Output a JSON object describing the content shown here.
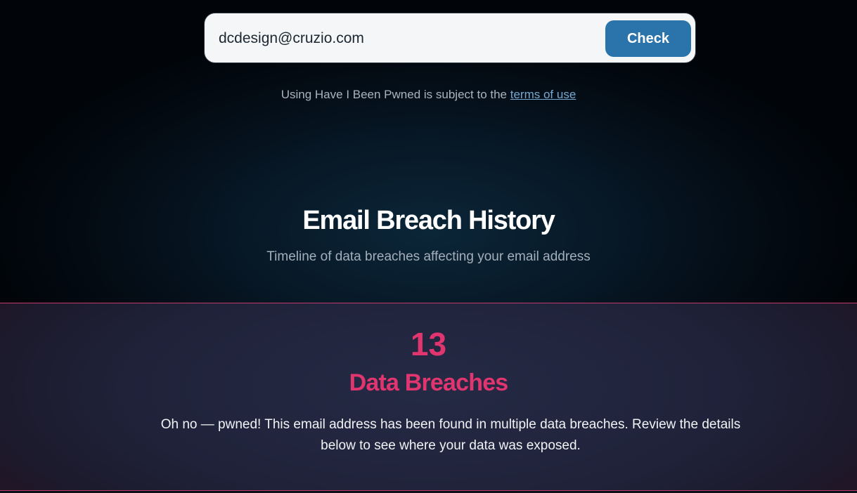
{
  "search": {
    "email_value": "dcdesign@cruzio.com",
    "check_label": "Check"
  },
  "terms": {
    "prefix": "Using Have I Been Pwned is subject to the ",
    "link_label": "terms of use"
  },
  "header": {
    "title": "Email Breach History",
    "subtitle": "Timeline of data breaches affecting your email address"
  },
  "summary": {
    "count": "13",
    "label": "Data Breaches",
    "message": "Oh no — pwned! This email address has been found in multiple data breaches. Review the details below to see where your data was exposed."
  },
  "colors": {
    "accent": "#e0356f",
    "button": "#2b74ab",
    "link": "#78a8cf"
  }
}
